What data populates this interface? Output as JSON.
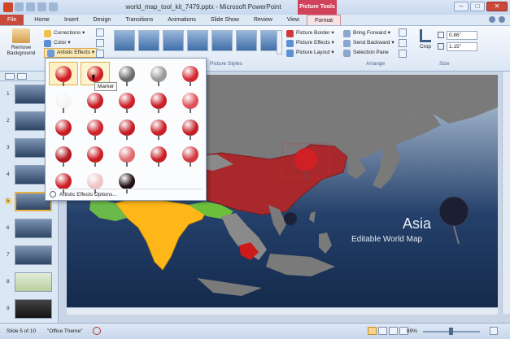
{
  "window": {
    "title": "world_map_tool_kit_7479.pptx - Microsoft PowerPoint",
    "contextual_tab_group": "Picture Tools"
  },
  "tabs": [
    "File",
    "Home",
    "Insert",
    "Design",
    "Transitions",
    "Animations",
    "Slide Show",
    "Review",
    "View",
    "Format"
  ],
  "ribbon": {
    "remove_background": "Remove Background",
    "corrections": "Corrections ▾",
    "color": "Color ▾",
    "artistic_effects": "Artistic Effects ▾",
    "picture_border": "Picture Border ▾",
    "picture_effects": "Picture Effects ▾",
    "picture_layout": "Picture Layout ▾",
    "bring_forward": "Bring Forward ▾",
    "send_backward": "Send Backward ▾",
    "selection_pane": "Selection Pane",
    "crop": "Crop",
    "height_value": "0.86\"",
    "width_value": "1.15\"",
    "group_picture_styles": "Picture Styles",
    "group_arrange": "Arrange",
    "group_size": "Size"
  },
  "artistic_effects_menu": {
    "tooltip": "Marker",
    "options_label": "Artistic Effects Options...",
    "effects": [
      {
        "name": "None",
        "color": "#d11f26"
      },
      {
        "name": "Marker",
        "color": "#cf1e25"
      },
      {
        "name": "Pencil Grayscale",
        "color": "#6b6b6b"
      },
      {
        "name": "Pencil Sketch",
        "color": "#9a9a9a"
      },
      {
        "name": "Line Drawing",
        "color": "#d42a30"
      },
      {
        "name": "Chalk Sketch",
        "color": "#f4f4f4"
      },
      {
        "name": "Paint Strokes",
        "color": "#c81d23"
      },
      {
        "name": "Paint Brush",
        "color": "#cc2027"
      },
      {
        "name": "Glow Diffused",
        "color": "#c91f26"
      },
      {
        "name": "Blur",
        "color": "#e0525a"
      },
      {
        "name": "Light Screen",
        "color": "#c71c22"
      },
      {
        "name": "Watercolor Sponge",
        "color": "#cf2229"
      },
      {
        "name": "Film Grain",
        "color": "#c41b22"
      },
      {
        "name": "Mosaic Bubbles",
        "color": "#ca1f26"
      },
      {
        "name": "Glass",
        "color": "#c62027"
      },
      {
        "name": "Cement",
        "color": "#b31820"
      },
      {
        "name": "Texturizer",
        "color": "#c91c23"
      },
      {
        "name": "Crisscross Etching",
        "color": "#e06b70"
      },
      {
        "name": "Pastels Smooth",
        "color": "#cb1e25"
      },
      {
        "name": "Plastic Wrap",
        "color": "#d3383e"
      },
      {
        "name": "Cutout",
        "color": "#cc1d24"
      },
      {
        "name": "Photocopy",
        "color": "#efc3c3"
      },
      {
        "name": "Glow Edges",
        "color": "#241012"
      }
    ]
  },
  "thumbnails": {
    "numbers": [
      "1",
      "2",
      "3",
      "4",
      "5",
      "6",
      "7",
      "8",
      "9"
    ],
    "active_index": 5
  },
  "slide": {
    "title": "Asia",
    "subtitle": "Editable World Map"
  },
  "statusbar": {
    "slide_info": "Slide 5 of 10",
    "theme": "\"Office Theme\"",
    "zoom": "89%"
  },
  "colors": {
    "china": "#a8282c",
    "india": "#ffb619",
    "land": "#7a7a7a",
    "ocean_top": "#bfd0e2",
    "ocean_bottom": "#152a4c",
    "accent": "#d0435a"
  }
}
